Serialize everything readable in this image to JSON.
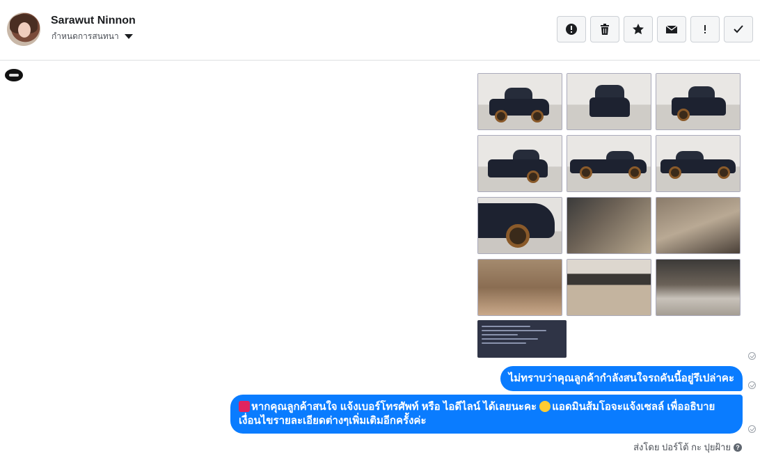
{
  "header": {
    "name": "Sarawut Ninnon",
    "subtitle": "กำหนดการสนทนา",
    "toolbar": [
      {
        "icon": "alert-circle-icon",
        "name": "spam-button"
      },
      {
        "icon": "trash-icon",
        "name": "delete-button"
      },
      {
        "icon": "star-icon",
        "name": "star-button"
      },
      {
        "icon": "mail-icon",
        "name": "mark-unread-button"
      },
      {
        "icon": "exclamation-icon",
        "name": "follow-up-button"
      },
      {
        "icon": "check-icon",
        "name": "mark-done-button"
      }
    ]
  },
  "colors": {
    "bubble": "#0a7cff",
    "border": "#dddfe2"
  },
  "messages": {
    "photo_count": 13,
    "bubble1": "ไม่ทราบว่าคุณลูกค้ากำลังสนใจรถคันนี้อยู่รึเปล่าคะ",
    "bubble2_line1": "หากคุณลูกค้าสนใจ แจ้งเบอร์โทรศัพท์ หรือ ไอดีไลน์  ได้เลยนะคะ",
    "bubble2_line1b": "แอดมินส้มโอจะแจ้งเซลล์   เพื่ออธิบาย",
    "bubble2_line2": "เงื่อนไขรายละเอียดต่างๆเพิ่มเติมอีกครั้งค่ะ",
    "sent_by": "ส่งโดย ปอร์โต้ กะ ปุยฝ้าย",
    "help_symbol": "?"
  }
}
